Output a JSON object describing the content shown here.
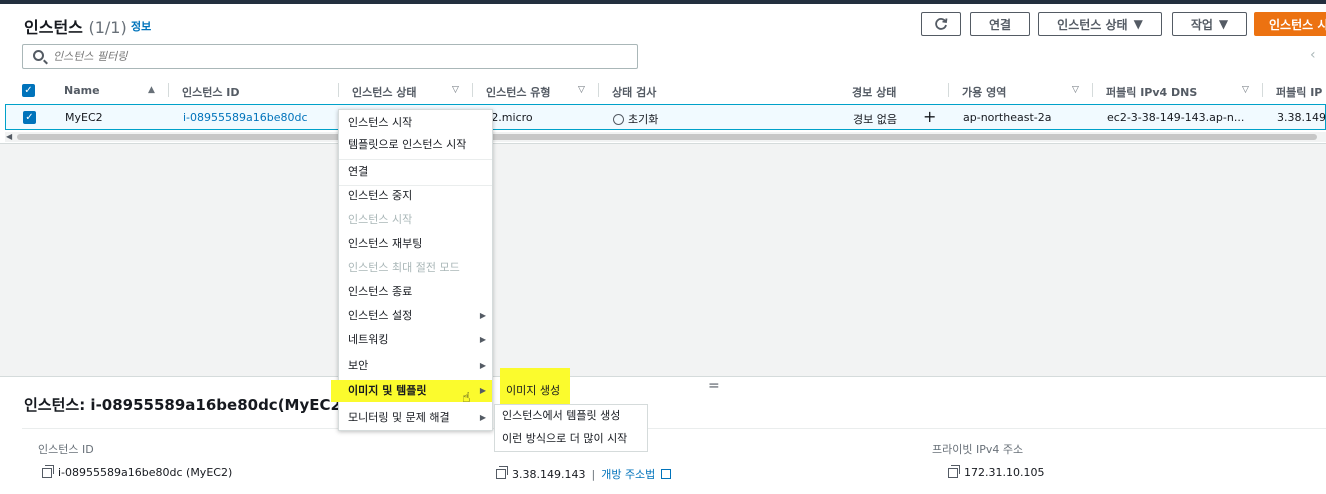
{
  "header": {
    "title": "인스턴스",
    "count": "(1/1)",
    "info": "정보"
  },
  "toolbar": {
    "refresh_icon": "refresh-icon",
    "connect": "연결",
    "instance_state": "인스턴스 상태",
    "actions": "작업",
    "launch": "인스턴스 시"
  },
  "search": {
    "placeholder": "인스턴스 필터링"
  },
  "table": {
    "columns": [
      "Name",
      "인스턴스 ID",
      "인스턴스 상태",
      "인스턴스 유형",
      "상태 검사",
      "경보 상태",
      "가용 영역",
      "퍼블릭 IPv4 DNS",
      "퍼블릭 IP"
    ],
    "row": {
      "name": "MyEC2",
      "instance_id": "i-08955589a16be80dc",
      "instance_type": "t2.micro",
      "status_check": "초기화",
      "alarm_status": "경보 없음",
      "availability_zone": "ap-northeast-2a",
      "public_dns": "ec2-3-38-149-143.ap-n...",
      "public_ip": "3.38.149."
    }
  },
  "context_menu": {
    "items": [
      {
        "label": "인스턴스 시작",
        "disabled": false,
        "submenu": false
      },
      {
        "label": "템플릿으로 인스턴스 시작",
        "disabled": false,
        "submenu": false
      },
      {
        "label": "연결",
        "disabled": false,
        "submenu": false
      },
      {
        "label": "인스턴스 중지",
        "disabled": false,
        "submenu": false
      },
      {
        "label": "인스턴스 시작",
        "disabled": true,
        "submenu": false
      },
      {
        "label": "인스턴스 재부팅",
        "disabled": false,
        "submenu": false
      },
      {
        "label": "인스턴스 최대 절전 모드",
        "disabled": true,
        "submenu": false
      },
      {
        "label": "인스턴스 종료",
        "disabled": false,
        "submenu": false
      },
      {
        "label": "인스턴스 설정",
        "disabled": false,
        "submenu": true
      },
      {
        "label": "네트워킹",
        "disabled": false,
        "submenu": true
      },
      {
        "label": "보안",
        "disabled": false,
        "submenu": true
      },
      {
        "label": "이미지 및 템플릿",
        "disabled": false,
        "submenu": true
      },
      {
        "label": "모니터링 및 문제 해결",
        "disabled": false,
        "submenu": true
      }
    ]
  },
  "submenu": {
    "items": [
      "이미지 생성",
      "인스턴스에서 템플릿 생성",
      "이런 방식으로 더 많이 시작"
    ]
  },
  "details": {
    "title": "인스턴스: i-08955589a16be80dc(MyEC2)",
    "instance_id_label": "인스턴스 ID",
    "instance_id_value": "i-08955589a16be80dc (MyEC2)",
    "public_ip_value": "3.38.149.143",
    "open_address": "개방 주소법",
    "private_ip_label": "프라이빗 IPv4 주소",
    "private_ip_value": "172.31.10.105"
  },
  "colors": {
    "primary": "#ec7211",
    "link": "#0073bb",
    "highlight": "#fbfb2d",
    "selected_row": "#f1faff"
  }
}
